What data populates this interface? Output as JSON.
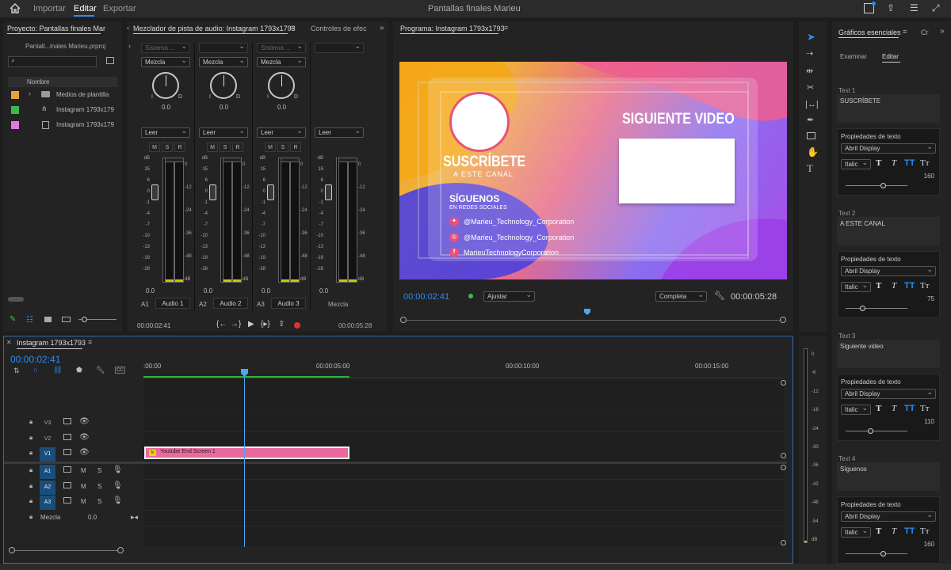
{
  "topbar": {
    "title": "Pantallas finales Marieu",
    "tabs": [
      "Importar",
      "Editar",
      "Exportar"
    ],
    "active_tab": "Editar"
  },
  "project": {
    "tab": "Proyecto: Pantallas finales Mar",
    "file": "Pantall...inales Marieu.prproj",
    "column": "Nombre",
    "items": [
      {
        "name": "Medios de plantilla",
        "color": "#e8a040"
      },
      {
        "name": "Instagram 1793x179",
        "color": "#3dba4f"
      },
      {
        "name": "Instagram 1793x179",
        "color": "#e07adf"
      }
    ]
  },
  "mixer": {
    "tab": "Mezclador de pista de audio: Instagram 1793x1793",
    "tab2": "Controles de efec",
    "channels": [
      {
        "route": "Sistema ...",
        "mix": "Mezcla",
        "pan": "0.0",
        "l": "I",
        "r": "D",
        "auto": "Leer",
        "vol": "0.0",
        "track": "A1",
        "name": "Audio 1"
      },
      {
        "route": "",
        "mix": "Mezcla",
        "pan": "0.0",
        "l": "I",
        "r": "D",
        "auto": "Leer",
        "vol": "0.0",
        "track": "A2",
        "name": "Audio 2"
      },
      {
        "route": "Sistema ...",
        "mix": "Mezcla",
        "pan": "0.0",
        "l": "I",
        "r": "D",
        "auto": "Leer",
        "vol": "0.0",
        "track": "A3",
        "name": "Audio 3"
      },
      {
        "route": "",
        "mix": "",
        "pan": "",
        "l": "",
        "r": "",
        "auto": "Leer",
        "vol": "0.0",
        "track": "",
        "name": "Mezcla"
      }
    ],
    "msr": [
      "M",
      "S",
      "R"
    ],
    "scale_left": [
      "dB",
      "15",
      "6",
      "0",
      "-1",
      "-4",
      "-7",
      "-10",
      "-13",
      "-19",
      "-28"
    ],
    "scale_right": [
      "0",
      "-12",
      "-24",
      "-36",
      "-48",
      "dB"
    ],
    "time_left": "00:00:02:41",
    "time_right": "00:00:05:28"
  },
  "program": {
    "tab": "Programa: Instagram 1793x1793",
    "time": "00:00:02:41",
    "fit": "Ajustar",
    "quality": "Completa",
    "duration": "00:00:05:28",
    "video": {
      "subscribe": "SUSCRÍBETE",
      "channel": "A ESTE CANAL",
      "next": "SIGUIENTE VIDEO",
      "follow": "SÍGUENOS",
      "social": "EN REDES SOCIALES",
      "handles": [
        "@Marieu_Technology_Corporation",
        "@Marieu_Technology_Corporation",
        "MarieuTechnologyCorporation"
      ]
    }
  },
  "timeline": {
    "tab": "Instagram 1793x1793",
    "time": "00:00:02:41",
    "ruler": [
      ":00:00",
      "00:00:05:00",
      "00:00:10:00",
      "00:00:15:00"
    ],
    "video_tracks": [
      "V3",
      "V2",
      "V1"
    ],
    "audio_tracks": [
      "A1",
      "A2",
      "A3"
    ],
    "mix_label": "Mezcla",
    "mix_value": "0.0",
    "clip": "Youtube End Screen 1",
    "meter": [
      "0",
      "-6",
      "-12",
      "-18",
      "-24",
      "-30",
      "-36",
      "-42",
      "-48",
      "-54",
      "dB"
    ]
  },
  "essential": {
    "tab": "Gráficos esenciales",
    "tab2": "Cr",
    "subtabs": [
      "Examinar",
      "Editar"
    ],
    "texts": [
      {
        "label": "Text 1",
        "value": "SUSCRÍBETE",
        "size": "160",
        "slider": 0.62
      },
      {
        "label": "Text 2",
        "value": "A ESTE CANAL",
        "size": "75",
        "slider": 0.28
      },
      {
        "label": "Text 3",
        "value": "Siguiente video",
        "size": "110",
        "slider": 0.41
      },
      {
        "label": "Text 4",
        "value": "Síguenos",
        "size": "160",
        "slider": 0.62
      }
    ],
    "props": "Propiedades de texto",
    "font": "Abril Display",
    "style": "Italic"
  }
}
